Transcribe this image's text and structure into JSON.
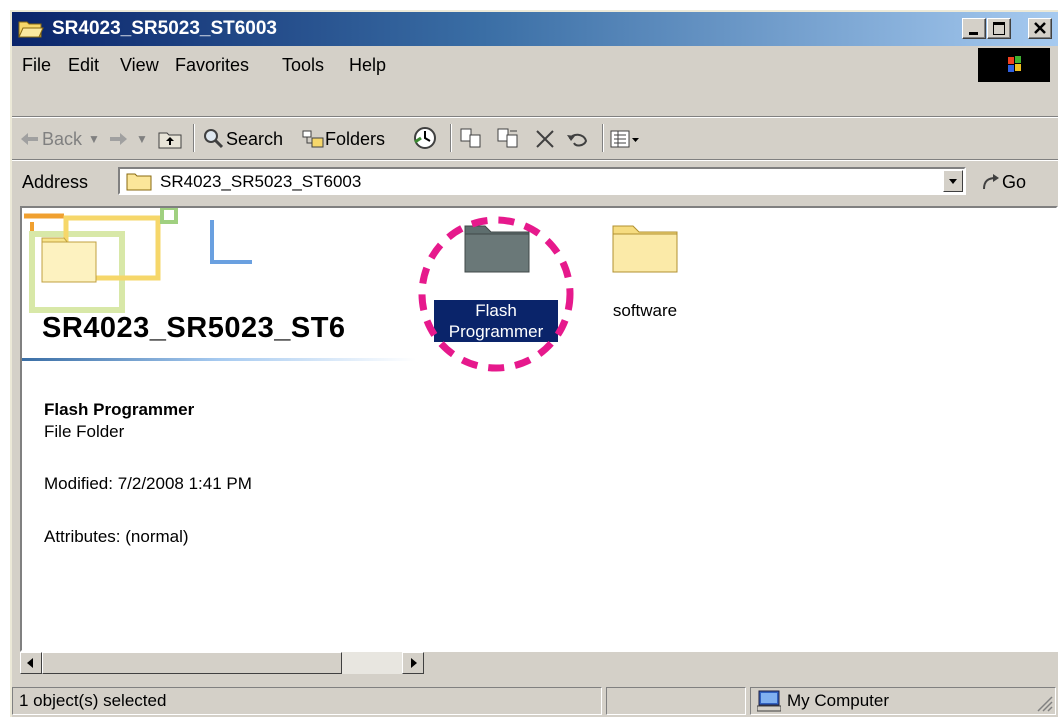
{
  "window": {
    "title": "SR4023_SR5023_ST6003",
    "icons": {
      "title": "folder-open-icon",
      "minimize": "minimize-icon",
      "maximize": "maximize-icon",
      "close": "close-icon"
    }
  },
  "menu": {
    "items": [
      "File",
      "Edit",
      "View",
      "Favorites",
      "Tools",
      "Help"
    ],
    "logo": "windows-logo-icon"
  },
  "toolbar": {
    "back_label": "Back",
    "search_label": "Search",
    "folders_label": "Folders",
    "icons": [
      "back-arrow-icon",
      "forward-arrow-icon",
      "up-folder-icon",
      "search-icon",
      "folders-icon",
      "history-icon",
      "move-to-icon",
      "copy-to-icon",
      "delete-icon",
      "undo-icon",
      "views-icon"
    ]
  },
  "address": {
    "label": "Address",
    "value": "SR4023_SR5023_ST6003",
    "go_label": "Go"
  },
  "content": {
    "info_title": "SR4023_SR5023_ST6",
    "selected_name": "Flash Programmer",
    "selected_type": "File Folder",
    "modified": "Modified: 7/2/2008 1:41 PM",
    "attributes": "Attributes: (normal)",
    "folders": [
      {
        "line1": "Flash",
        "line2": "Programmer",
        "selected": true
      },
      {
        "line1": "software",
        "line2": "",
        "selected": false
      }
    ],
    "highlight_color": "#e6198c",
    "selection_color": "#0a246a"
  },
  "status": {
    "selection": "1 object(s) selected",
    "zone": "My Computer"
  }
}
